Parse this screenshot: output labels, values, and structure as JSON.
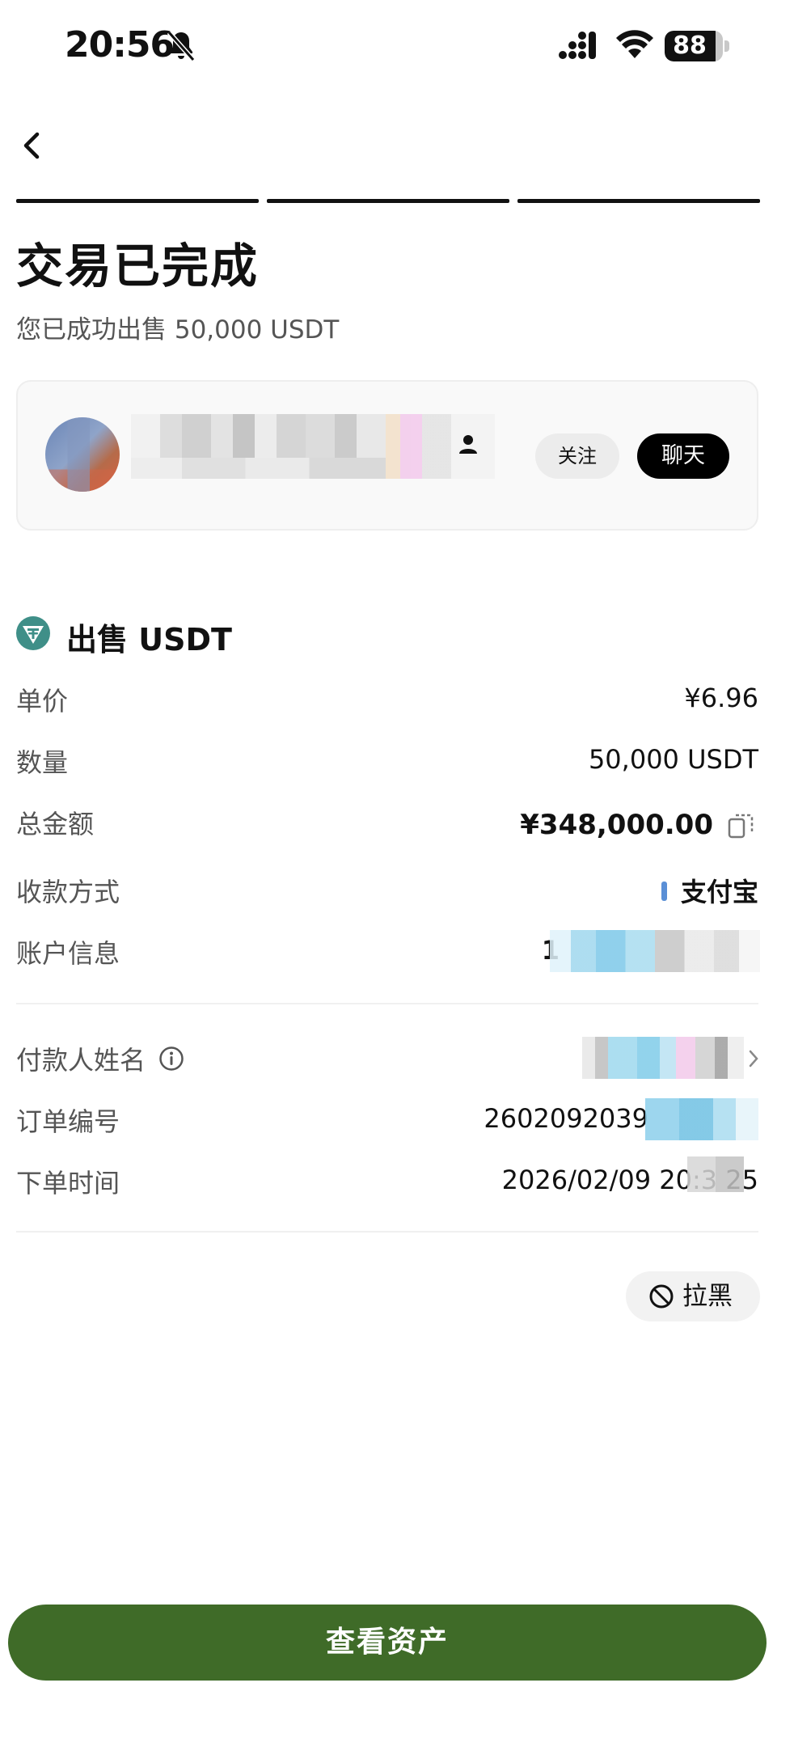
{
  "status_bar": {
    "time": "20:56",
    "battery": "88",
    "battery_level": 0.88,
    "icons": [
      "bell-slash-icon",
      "signal-icon",
      "wifi-icon",
      "battery-icon"
    ]
  },
  "nav": {
    "back_icon": "chevron-left-icon",
    "progress_steps": 3,
    "progress_completed": 3
  },
  "header": {
    "title": "交易已完成",
    "subtitle": "您已成功出售 50,000 USDT"
  },
  "merchant": {
    "follow_label": "关注",
    "chat_label": "聊天"
  },
  "order": {
    "section_title": "出售 USDT",
    "section_icon": "tether-icon",
    "unit_price_label": "单价",
    "unit_price_value": "¥6.96",
    "quantity_label": "数量",
    "quantity_value": "50,000 USDT",
    "total_label": "总金额",
    "total_value": "¥348,000.00",
    "payment_method_label": "收款方式",
    "payment_method_value": "支付宝",
    "payment_method_color": "#5a8fd6",
    "account_label": "账户信息",
    "account_value_visible": "1",
    "payer_name_label": "付款人姓名",
    "order_no_label": "订单编号",
    "order_no_value_visible": "2602092039",
    "order_time_label": "下单时间",
    "order_time_value": "2026/02/09 20:3  25"
  },
  "actions": {
    "block_label": "拉黑",
    "primary_label": "查看资产",
    "primary_color": "#3f6b28"
  }
}
